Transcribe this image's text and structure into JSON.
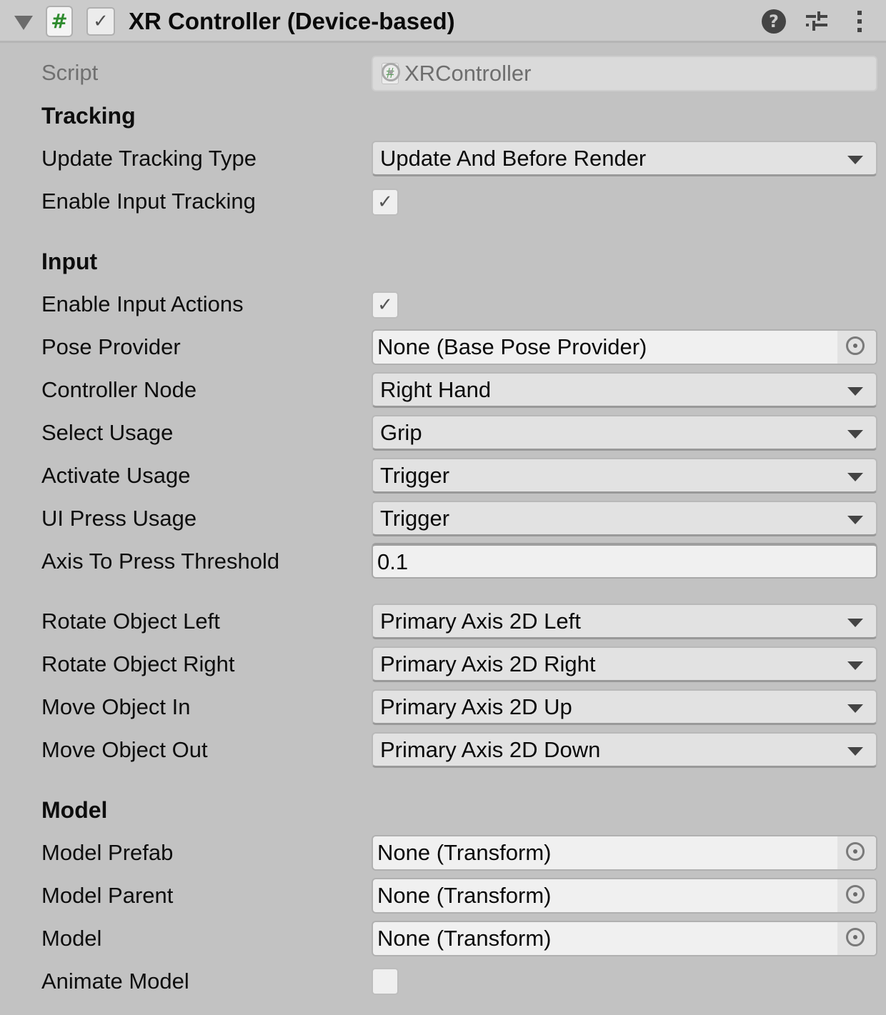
{
  "header": {
    "title": "XR Controller (Device-based)",
    "script_icon_glyph": "#",
    "enabled": true,
    "check_glyph": "✓",
    "icons": [
      "foldout-arrow-icon",
      "script-icon",
      "help-icon",
      "presets-icon",
      "kebab-menu-icon"
    ],
    "help_glyph": "?"
  },
  "script": {
    "label": "Script",
    "value": "XRController",
    "icon_glyph": "#"
  },
  "sections": {
    "tracking": "Tracking",
    "input": "Input",
    "model": "Model"
  },
  "tracking": {
    "update_tracking_type": {
      "label": "Update Tracking Type",
      "value": "Update And Before Render"
    },
    "enable_input_tracking": {
      "label": "Enable Input Tracking",
      "checked": true,
      "glyph": "✓"
    }
  },
  "input": {
    "enable_input_actions": {
      "label": "Enable Input Actions",
      "checked": true,
      "glyph": "✓"
    },
    "pose_provider": {
      "label": "Pose Provider",
      "value": "None (Base Pose Provider)"
    },
    "controller_node": {
      "label": "Controller Node",
      "value": "Right Hand"
    },
    "select_usage": {
      "label": "Select Usage",
      "value": "Grip"
    },
    "activate_usage": {
      "label": "Activate Usage",
      "value": "Trigger"
    },
    "ui_press_usage": {
      "label": "UI Press Usage",
      "value": "Trigger"
    },
    "axis_to_press_threshold": {
      "label": "Axis To Press Threshold",
      "value": "0.1"
    },
    "rotate_object_left": {
      "label": "Rotate Object Left",
      "value": "Primary Axis 2D Left"
    },
    "rotate_object_right": {
      "label": "Rotate Object Right",
      "value": "Primary Axis 2D Right"
    },
    "move_object_in": {
      "label": "Move Object In",
      "value": "Primary Axis 2D Up"
    },
    "move_object_out": {
      "label": "Move Object Out",
      "value": "Primary Axis 2D Down"
    }
  },
  "model": {
    "model_prefab": {
      "label": "Model Prefab",
      "value": "None (Transform)"
    },
    "model_parent": {
      "label": "Model Parent",
      "value": "None (Transform)"
    },
    "model": {
      "label": "Model",
      "value": "None (Transform)"
    },
    "animate_model": {
      "label": "Animate Model",
      "checked": false
    }
  }
}
